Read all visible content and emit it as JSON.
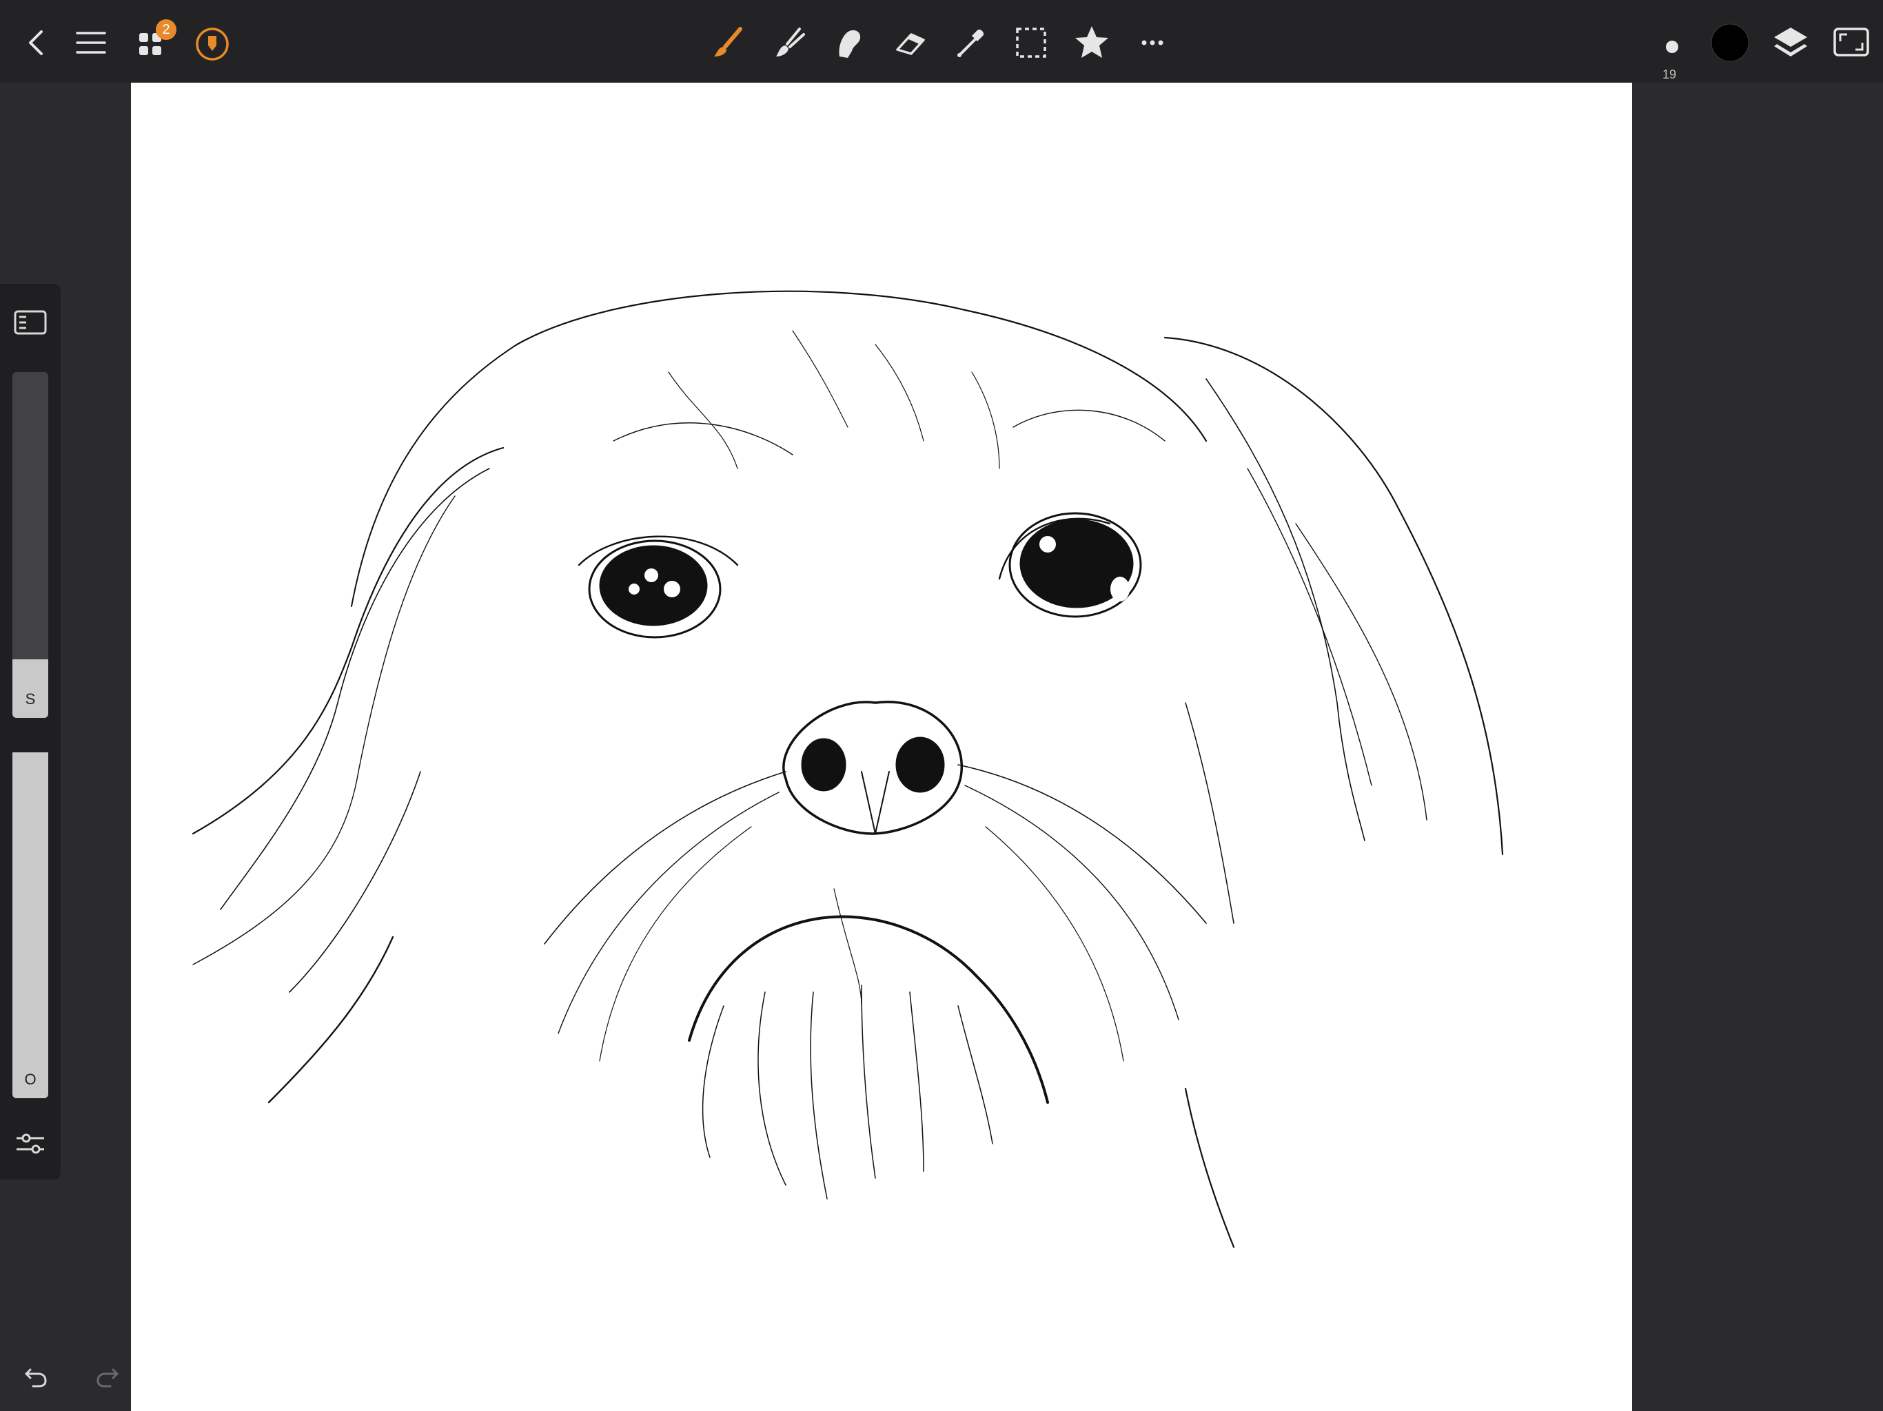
{
  "app": {
    "layers_badge_count": "2",
    "brush_size_value": "19",
    "current_color": "#000000",
    "accent_color": "#e8892b"
  },
  "sliders": {
    "size_label": "S",
    "size_value": 0.17,
    "opacity_label": "O",
    "opacity_value": 1.0
  },
  "toolbar": {
    "left": [
      "back-icon",
      "menu-icon",
      "gallery-icon",
      "pencil-badge-icon"
    ],
    "center": [
      "brush-icon",
      "smudge-icon",
      "fill-icon",
      "eraser-icon",
      "eyedropper-icon",
      "selection-icon",
      "star-icon",
      "more-icon"
    ],
    "right": [
      "brush-size-dot",
      "color-swatch",
      "layers-icon",
      "fullscreen-icon"
    ]
  }
}
